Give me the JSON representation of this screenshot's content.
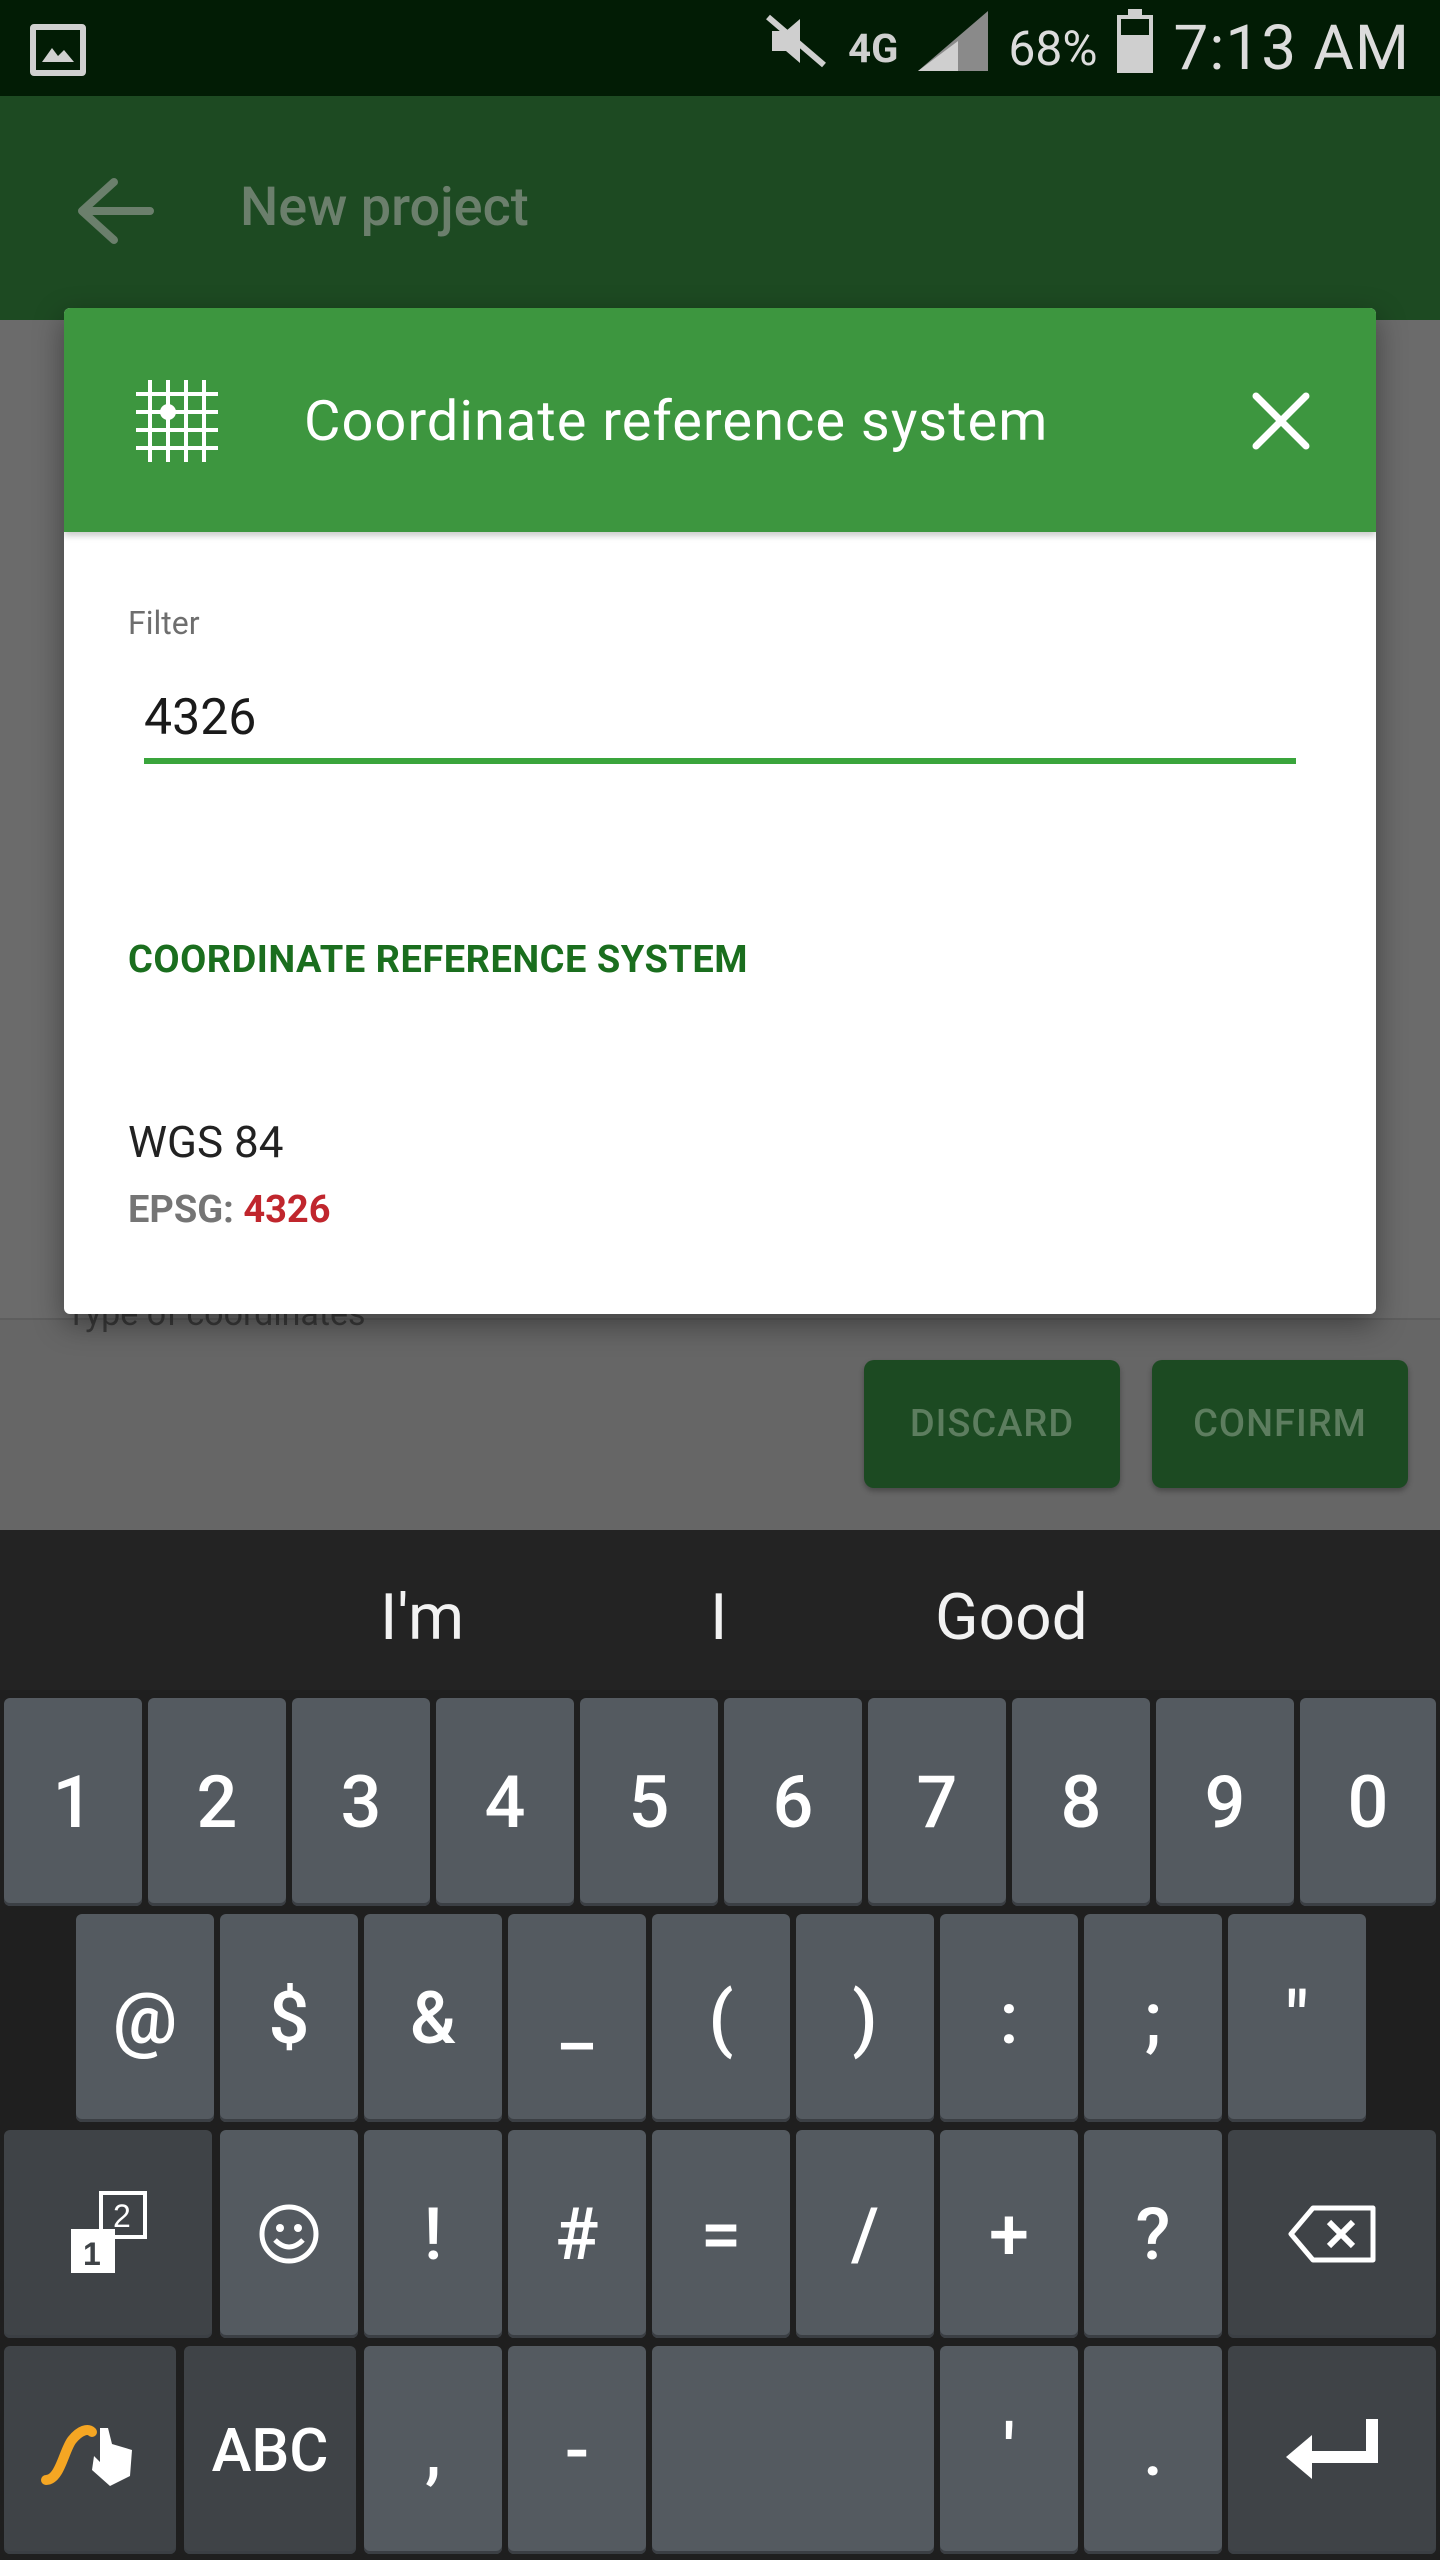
{
  "status_bar": {
    "battery": "68%",
    "time": "7:13 AM",
    "network": "4G"
  },
  "app_bar": {
    "title": "New project"
  },
  "background_form": {
    "partial_label": "Type of coordinates",
    "discard_label": "DISCARD",
    "confirm_label": "CONFIRM"
  },
  "dialog": {
    "title": "Coordinate reference system",
    "filter_label": "Filter",
    "filter_value": "4326",
    "section_header": "COORDINATE REFERENCE SYSTEM",
    "results": [
      {
        "name": "WGS 84",
        "code_prefix": "EPSG: ",
        "code": "4326"
      }
    ]
  },
  "keyboard": {
    "suggestions": [
      "I'm",
      "I",
      "Good"
    ],
    "row1": [
      "1",
      "2",
      "3",
      "4",
      "5",
      "6",
      "7",
      "8",
      "9",
      "0"
    ],
    "row2": [
      "@",
      "$",
      "&",
      "_",
      "(",
      ")",
      ":",
      ";",
      "\""
    ],
    "row3": [
      "!",
      "#",
      "=",
      "/",
      "+",
      "?"
    ],
    "row4": {
      "abc": "ABC",
      "comma": ",",
      "dash": "-",
      "apostrophe": "'",
      "period": "."
    }
  },
  "colors": {
    "header_green": "#3d963f",
    "accent_green": "#3aa53c",
    "section_green": "#1a6e1e",
    "highlight_red": "#c0262d"
  }
}
